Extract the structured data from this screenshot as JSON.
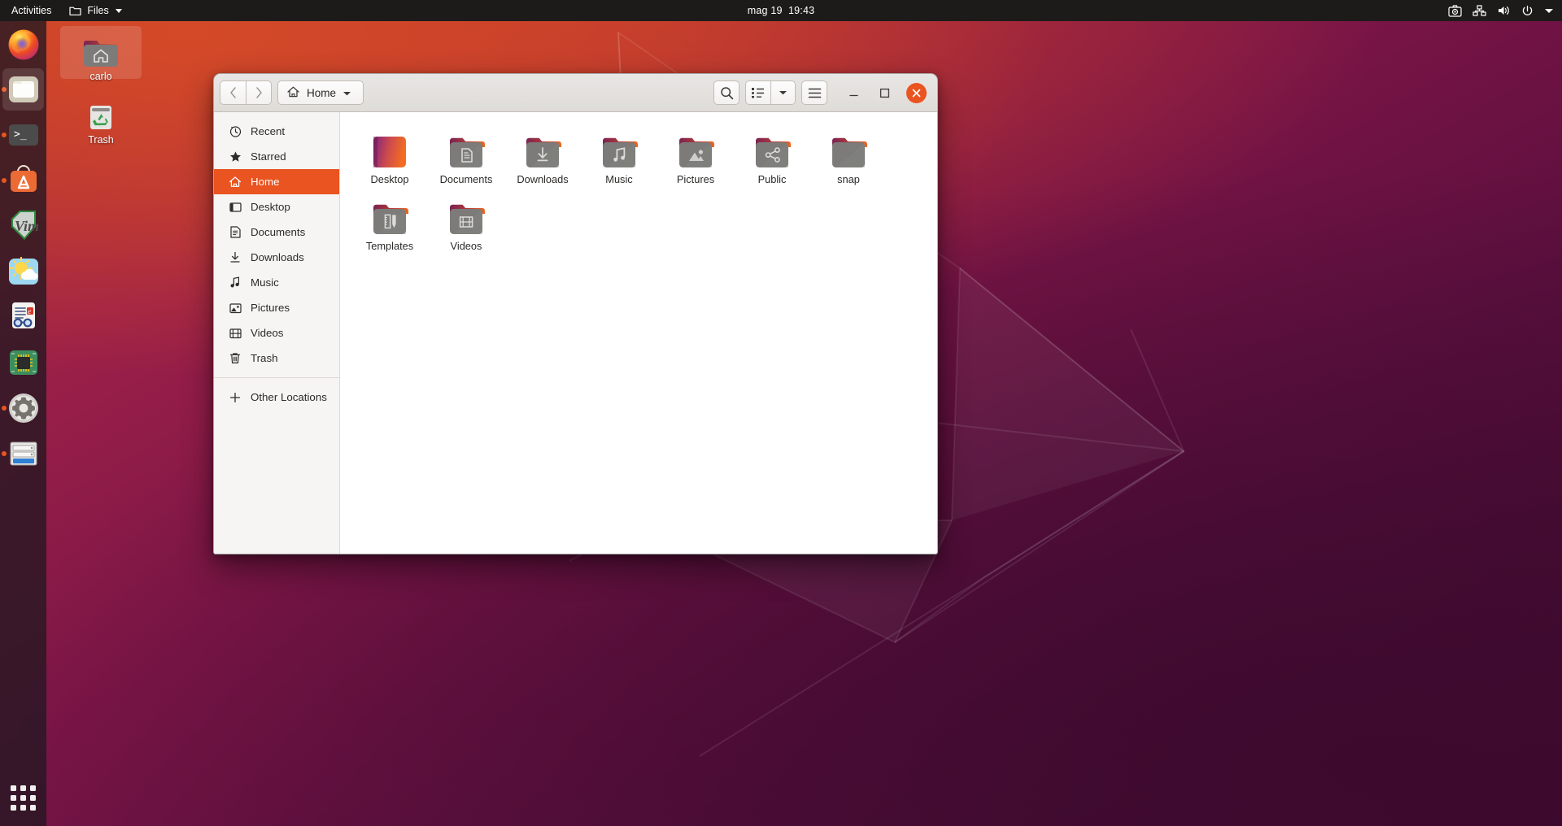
{
  "topbar": {
    "activities": "Activities",
    "app_name": "Files",
    "app_icon": "folder-icon",
    "clock": "mag 19  19:43",
    "tray": [
      {
        "name": "screenshot-icon",
        "label": "Screenshot"
      },
      {
        "name": "network-icon",
        "label": "Network"
      },
      {
        "name": "volume-icon",
        "label": "Volume"
      },
      {
        "name": "power-icon",
        "label": "Power"
      },
      {
        "name": "chevron-down-icon",
        "label": "System menu"
      }
    ]
  },
  "dock": {
    "items": [
      {
        "name": "dock-item-firefox",
        "label": "Firefox",
        "icon": "firefox-icon",
        "running": false,
        "active": false
      },
      {
        "name": "dock-item-files",
        "label": "Files",
        "icon": "files-icon",
        "running": true,
        "active": true
      },
      {
        "name": "dock-item-terminal",
        "label": "Terminal",
        "icon": "terminal-icon",
        "running": true,
        "active": false
      },
      {
        "name": "dock-item-software",
        "label": "Ubuntu Software",
        "icon": "software-store-icon",
        "running": true,
        "active": false
      },
      {
        "name": "dock-item-vim",
        "label": "Vim",
        "icon": "vim-icon",
        "running": false,
        "active": false
      },
      {
        "name": "dock-item-weather",
        "label": "Weather",
        "icon": "weather-icon",
        "running": false,
        "active": false
      },
      {
        "name": "dock-item-document-viewer",
        "label": "Document Viewer",
        "icon": "document-viewer-icon",
        "running": false,
        "active": false
      },
      {
        "name": "dock-item-circuit",
        "label": "Hardware",
        "icon": "circuit-chip-icon",
        "running": false,
        "active": false
      },
      {
        "name": "dock-item-settings",
        "label": "Settings",
        "icon": "gear-icon",
        "running": true,
        "active": false
      },
      {
        "name": "dock-item-servers",
        "label": "Virtual Machine Manager",
        "icon": "server-icon",
        "running": true,
        "active": false
      }
    ],
    "show_apps_label": "Show Applications"
  },
  "desktop": {
    "icons": [
      {
        "name": "desktop-icon-carlo",
        "label": "carlo",
        "icon": "home-folder-icon",
        "selected": true
      },
      {
        "name": "desktop-icon-trash",
        "label": "Trash",
        "icon": "trash-icon",
        "selected": false
      }
    ]
  },
  "window": {
    "title": "Home",
    "path_label": "Home",
    "nav": {
      "back_label": "Back",
      "forward_label": "Forward"
    },
    "toolbar": {
      "search_label": "Search",
      "view_toggle_label": "List view",
      "view_options_label": "View options",
      "menu_label": "Main menu",
      "minimize_label": "Minimize",
      "maximize_label": "Maximize",
      "close_label": "Close"
    },
    "sidebar": {
      "items": [
        {
          "label": "Recent",
          "icon": "clock-icon",
          "selected": false
        },
        {
          "label": "Starred",
          "icon": "star-icon",
          "selected": false
        },
        {
          "label": "Home",
          "icon": "home-icon",
          "selected": true
        },
        {
          "label": "Desktop",
          "icon": "desktop-icon",
          "selected": false
        },
        {
          "label": "Documents",
          "icon": "document-icon",
          "selected": false
        },
        {
          "label": "Downloads",
          "icon": "download-icon",
          "selected": false
        },
        {
          "label": "Music",
          "icon": "music-note-icon",
          "selected": false
        },
        {
          "label": "Pictures",
          "icon": "picture-icon",
          "selected": false
        },
        {
          "label": "Videos",
          "icon": "film-icon",
          "selected": false
        },
        {
          "label": "Trash",
          "icon": "trash-icon",
          "selected": false
        }
      ],
      "other_locations": {
        "label": "Other Locations",
        "icon": "plus-icon"
      }
    },
    "files": [
      {
        "label": "Desktop",
        "icon": "desktop-gradient-icon"
      },
      {
        "label": "Documents",
        "icon": "folder-documents-icon"
      },
      {
        "label": "Downloads",
        "icon": "folder-downloads-icon"
      },
      {
        "label": "Music",
        "icon": "folder-music-icon"
      },
      {
        "label": "Pictures",
        "icon": "folder-pictures-icon"
      },
      {
        "label": "Public",
        "icon": "folder-public-icon"
      },
      {
        "label": "snap",
        "icon": "folder-plain-icon"
      },
      {
        "label": "Templates",
        "icon": "folder-templates-icon"
      },
      {
        "label": "Videos",
        "icon": "folder-videos-icon"
      }
    ]
  },
  "colors": {
    "accent": "#e95420",
    "topbar_bg": "#1d1b1a",
    "dock_bg": "#261822",
    "folder_body": "#7c7b79"
  }
}
